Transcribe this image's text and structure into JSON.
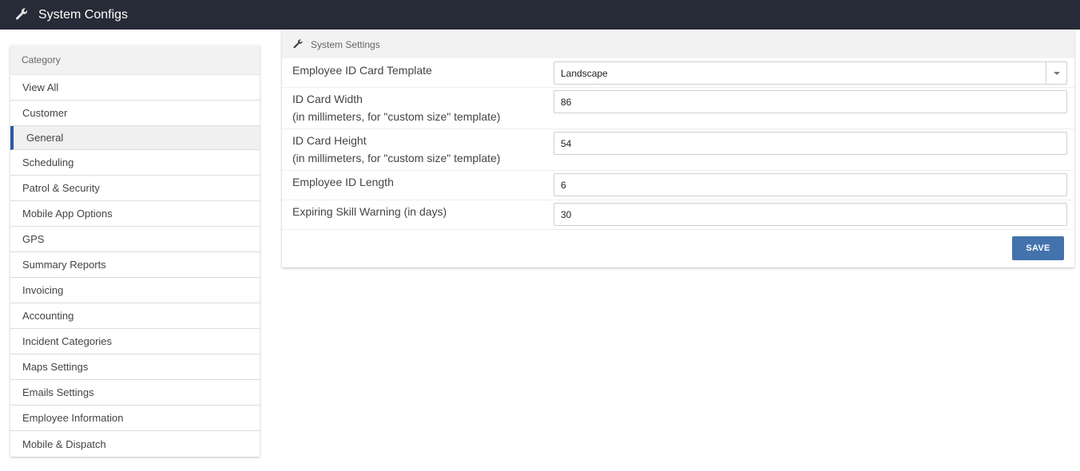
{
  "header": {
    "title": "System Configs",
    "icon": "wrench-icon"
  },
  "sidebar": {
    "heading": "Category",
    "items": [
      {
        "label": "View All"
      },
      {
        "label": "Customer"
      },
      {
        "label": "General",
        "selected": true
      },
      {
        "label": "Scheduling"
      },
      {
        "label": "Patrol & Security"
      },
      {
        "label": "Mobile App Options"
      },
      {
        "label": "GPS"
      },
      {
        "label": "Summary Reports"
      },
      {
        "label": "Invoicing"
      },
      {
        "label": "Accounting"
      },
      {
        "label": "Incident Categories"
      },
      {
        "label": "Maps Settings"
      },
      {
        "label": "Emails Settings"
      },
      {
        "label": "Employee Information"
      },
      {
        "label": "Mobile & Dispatch"
      }
    ]
  },
  "panel": {
    "title": "System Settings",
    "icon": "wrench-icon",
    "fields": [
      {
        "label": "Employee ID Card Template",
        "value": "Landscape",
        "type": "select"
      },
      {
        "label": "ID Card Width",
        "sublabel": "(in millimeters, for \"custom size\" template)",
        "value": "86"
      },
      {
        "label": "ID Card Height",
        "sublabel": "(in millimeters, for \"custom size\" template)",
        "value": "54"
      },
      {
        "label": "Employee ID Length",
        "value": "6"
      },
      {
        "label": "Expiring Skill Warning (in days)",
        "value": "30"
      }
    ],
    "save_label": "SAVE"
  },
  "colors": {
    "topbar": "#272b37",
    "accent": "#2b58a6",
    "save_button": "#4372ac"
  }
}
